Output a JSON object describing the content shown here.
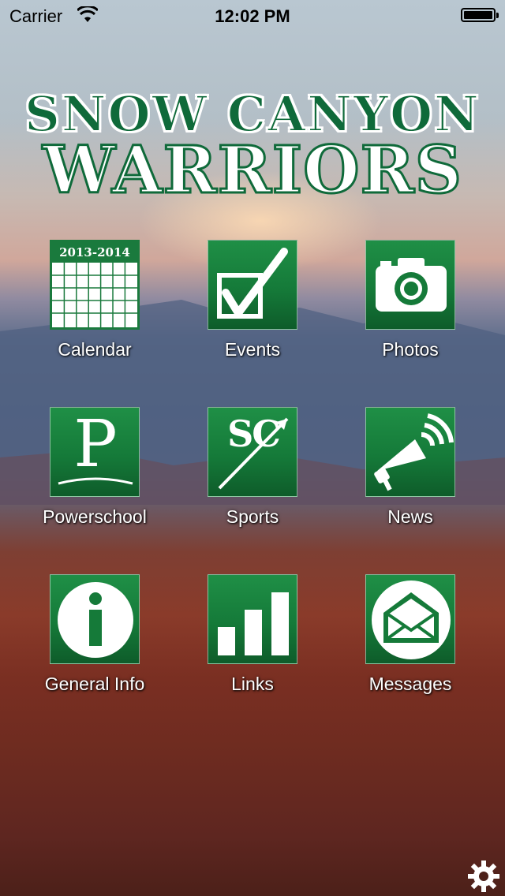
{
  "status_bar": {
    "carrier": "Carrier",
    "time": "12:02 PM",
    "wifi_icon": "wifi-icon",
    "battery_icon": "battery-icon"
  },
  "header": {
    "line1": "SNOW CANYON",
    "line2": "WARRIORS"
  },
  "colors": {
    "brand_green": "#157a39",
    "label": "#ffffff"
  },
  "tiles": [
    {
      "label": "Calendar",
      "icon": "calendar-icon",
      "calendar_year": "2013-2014"
    },
    {
      "label": "Events",
      "icon": "checkbox-icon"
    },
    {
      "label": "Photos",
      "icon": "camera-icon"
    },
    {
      "label": "Powerschool",
      "icon": "powerschool-icon",
      "glyph": "P"
    },
    {
      "label": "Sports",
      "icon": "sports-icon",
      "glyph": "SC"
    },
    {
      "label": "News",
      "icon": "megaphone-icon"
    },
    {
      "label": "General Info",
      "icon": "info-icon",
      "glyph": "i"
    },
    {
      "label": "Links",
      "icon": "bar-chart-icon"
    },
    {
      "label": "Messages",
      "icon": "envelope-icon"
    }
  ],
  "settings": {
    "icon": "gear-icon"
  }
}
